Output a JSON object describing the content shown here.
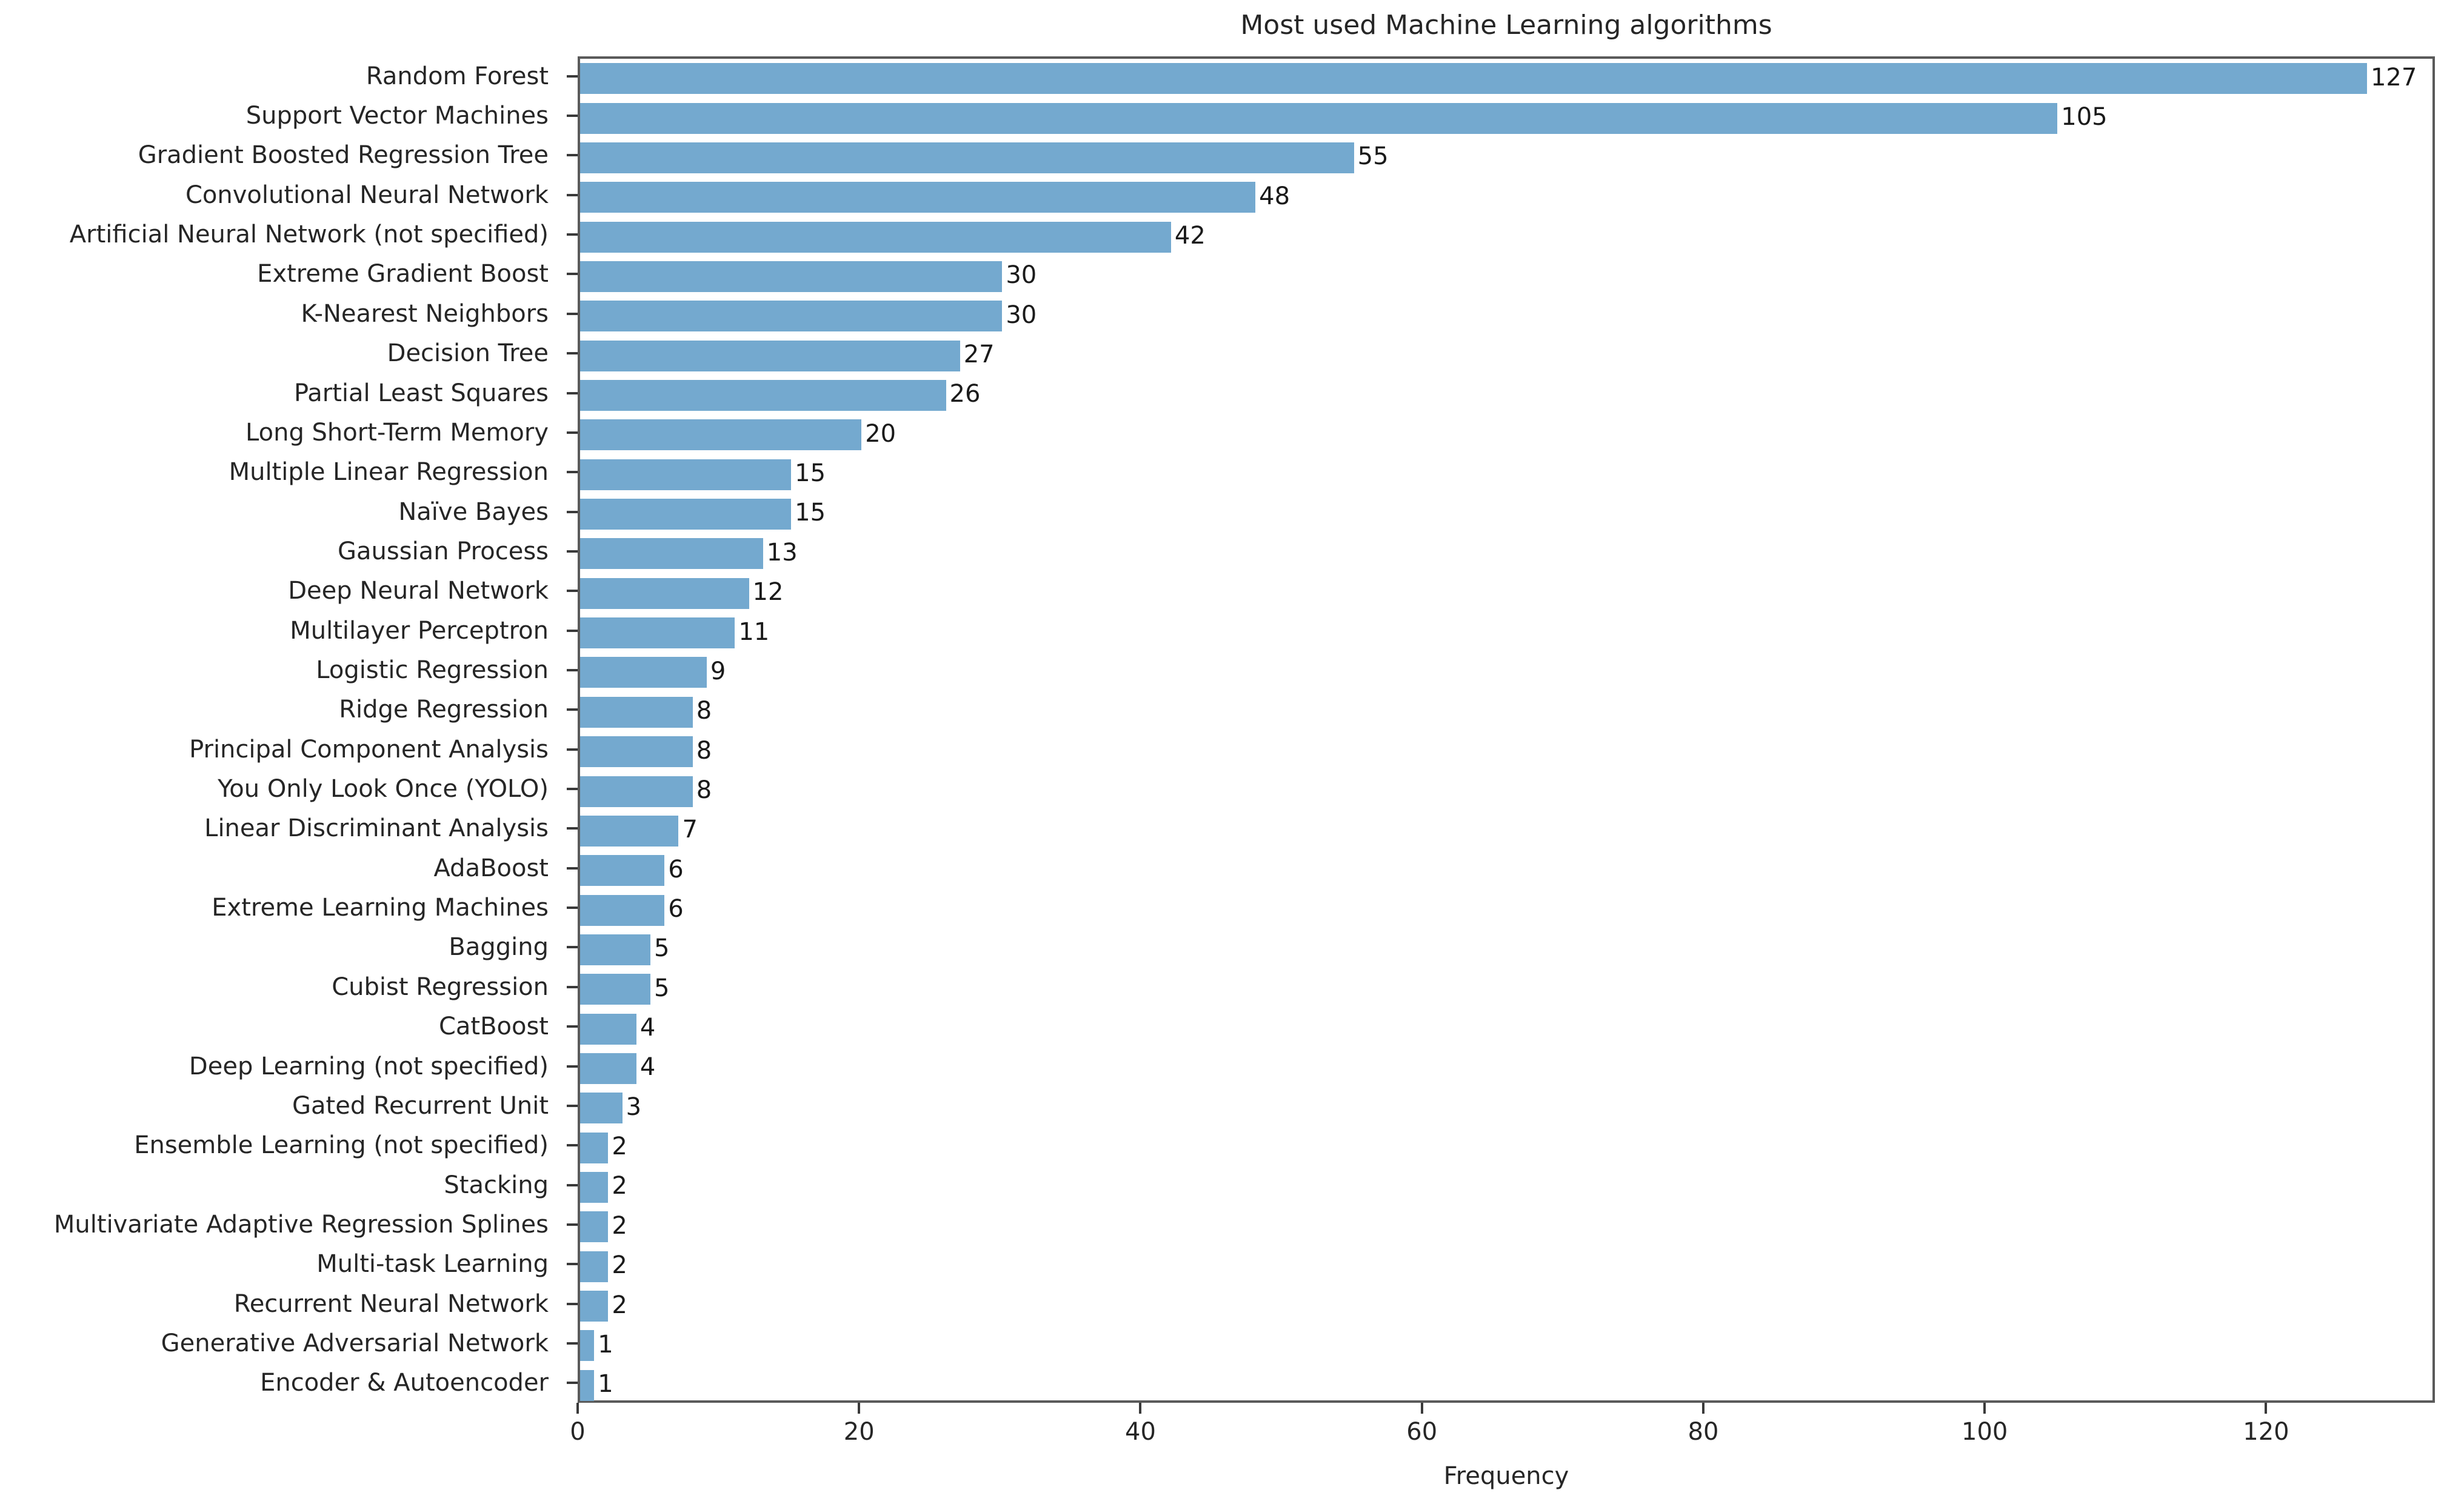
{
  "chart_data": {
    "type": "bar",
    "orientation": "horizontal",
    "title": "Most used Machine Learning algorithms",
    "xlabel": "Frequency",
    "ylabel": "",
    "xlim": [
      0,
      132
    ],
    "ylim": [
      0,
      34
    ],
    "grid": false,
    "legend": null,
    "bar_color": "#74a9cf",
    "xticks": [
      0,
      20,
      40,
      60,
      80,
      100,
      120
    ],
    "xtick_labels": [
      "0",
      "20",
      "40",
      "60",
      "80",
      "100",
      "120"
    ],
    "categories": [
      "Random Forest",
      "Support Vector Machines",
      "Gradient Boosted Regression Tree",
      "Convolutional Neural Network",
      "Artificial Neural Network (not specified)",
      "Extreme Gradient Boost",
      "K-Nearest Neighbors",
      "Decision Tree",
      "Partial Least Squares",
      "Long Short-Term Memory",
      "Multiple Linear Regression",
      "Naïve Bayes",
      "Gaussian Process",
      "Deep Neural Network",
      "Multilayer Perceptron",
      "Logistic Regression",
      "Ridge Regression",
      "Principal Component Analysis",
      "You Only Look Once (YOLO)",
      "Linear Discriminant Analysis",
      "AdaBoost",
      "Extreme Learning Machines",
      "Bagging",
      "Cubist Regression",
      "CatBoost",
      "Deep Learning (not specified)",
      "Gated Recurrent Unit",
      "Ensemble Learning (not specified)",
      "Stacking",
      "Multivariate Adaptive Regression Splines",
      "Multi-task Learning",
      "Recurrent Neural Network",
      "Generative Adversarial Network",
      "Encoder & Autoencoder"
    ],
    "values": [
      127,
      105,
      55,
      48,
      42,
      30,
      30,
      27,
      26,
      20,
      15,
      15,
      13,
      12,
      11,
      9,
      8,
      8,
      8,
      7,
      6,
      6,
      5,
      5,
      4,
      4,
      3,
      2,
      2,
      2,
      2,
      2,
      1,
      1
    ],
    "value_labels": [
      "127",
      "105",
      "55",
      "48",
      "42",
      "30",
      "30",
      "27",
      "26",
      "20",
      "15",
      "15",
      "13",
      "12",
      "11",
      "9",
      "8",
      "8",
      "8",
      "7",
      "6",
      "6",
      "5",
      "5",
      "4",
      "4",
      "3",
      "2",
      "2",
      "2",
      "2",
      "2",
      "1",
      "1"
    ]
  }
}
